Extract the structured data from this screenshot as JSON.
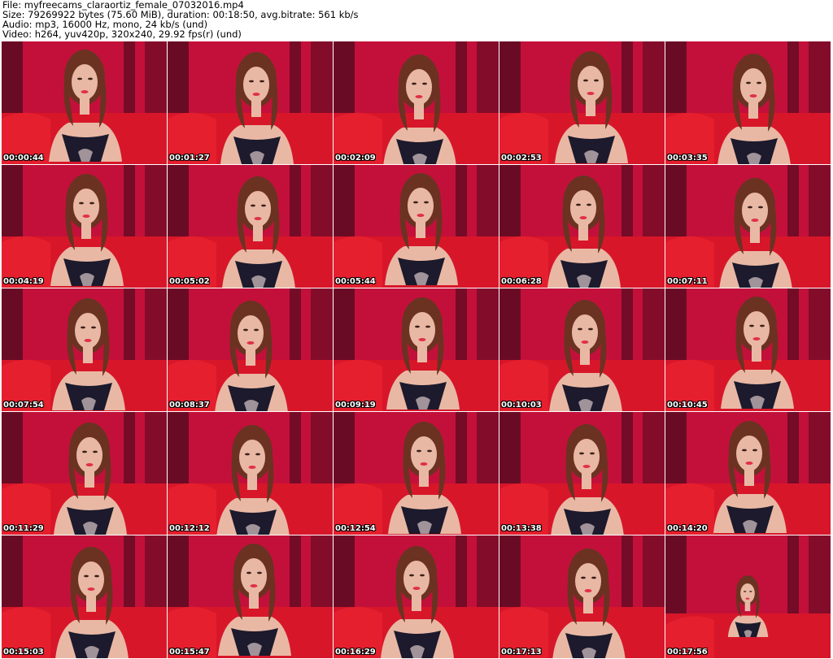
{
  "header": {
    "file_line": "File: myfreecams_claraortiz_female_07032016.mp4",
    "size_line": "Size: 79269922 bytes (75.60 MiB), duration: 00:18:50, avg.bitrate: 561 kb/s",
    "audio_line": "Audio: mp3, 16000 Hz, mono, 24 kb/s (und)",
    "video_line": "Video: h264, yuv420p, 320x240, 29.92 fps(r) (und)"
  },
  "thumbnails": [
    {
      "timestamp": "00:00:44"
    },
    {
      "timestamp": "00:01:27"
    },
    {
      "timestamp": "00:02:09"
    },
    {
      "timestamp": "00:02:53"
    },
    {
      "timestamp": "00:03:35"
    },
    {
      "timestamp": "00:04:19"
    },
    {
      "timestamp": "00:05:02"
    },
    {
      "timestamp": "00:05:44"
    },
    {
      "timestamp": "00:06:28"
    },
    {
      "timestamp": "00:07:11"
    },
    {
      "timestamp": "00:07:54"
    },
    {
      "timestamp": "00:08:37"
    },
    {
      "timestamp": "00:09:19"
    },
    {
      "timestamp": "00:10:03"
    },
    {
      "timestamp": "00:10:45"
    },
    {
      "timestamp": "00:11:29"
    },
    {
      "timestamp": "00:12:12"
    },
    {
      "timestamp": "00:12:54"
    },
    {
      "timestamp": "00:13:38"
    },
    {
      "timestamp": "00:14:20"
    },
    {
      "timestamp": "00:15:03"
    },
    {
      "timestamp": "00:15:47"
    },
    {
      "timestamp": "00:16:29"
    },
    {
      "timestamp": "00:17:13"
    },
    {
      "timestamp": "00:17:56"
    }
  ],
  "colors": {
    "background_red": "#c3103a",
    "curtain_dark": "#5a0a22",
    "sofa_red": "#d8162a",
    "skin": "#e9b8a4",
    "hair": "#6b3222",
    "top_dark": "#1c1a2c"
  }
}
